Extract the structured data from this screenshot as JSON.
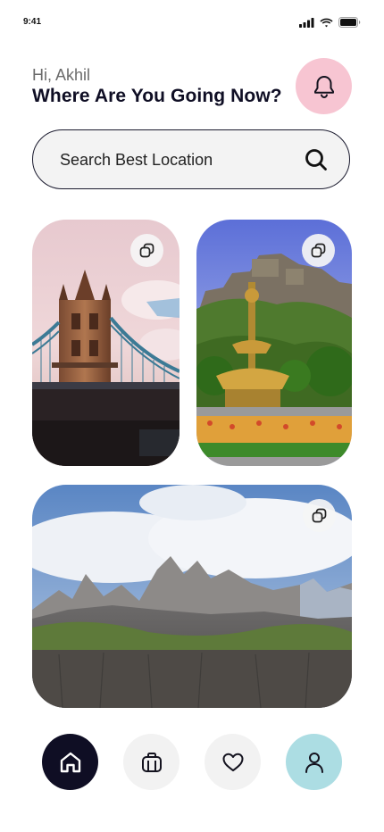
{
  "status_bar": {
    "time": "9:41",
    "icons": [
      "cellular-signal-icon",
      "wifi-icon",
      "battery-icon"
    ]
  },
  "header": {
    "greeting": "Hi, Akhil",
    "headline": "Where Are You Going Now?",
    "notification_icon": "bell-icon"
  },
  "search": {
    "placeholder": "Search Best Location",
    "value": "",
    "icon": "search-icon"
  },
  "destinations": [
    {
      "scene": "Tower bridge at sunset with pink sky",
      "action_icon": "copy-icon"
    },
    {
      "scene": "Castle on hill with golden fountain and garden",
      "action_icon": "copy-icon"
    },
    {
      "scene": "Rocky mountain range under cloudy sky",
      "action_icon": "copy-icon"
    }
  ],
  "bottom_nav": [
    {
      "icon": "home-icon",
      "active": true
    },
    {
      "icon": "bag-icon",
      "active": false
    },
    {
      "icon": "heart-icon",
      "active": false
    },
    {
      "icon": "user-icon",
      "active": false
    }
  ],
  "colors": {
    "headline": "#0f0e24",
    "notify_bg": "#f7c5d2",
    "search_bg": "#f3f3f3",
    "nav_active": "#0f0e24",
    "nav_inactive": "#f2f2f2",
    "profile_bg": "#acdde3"
  }
}
